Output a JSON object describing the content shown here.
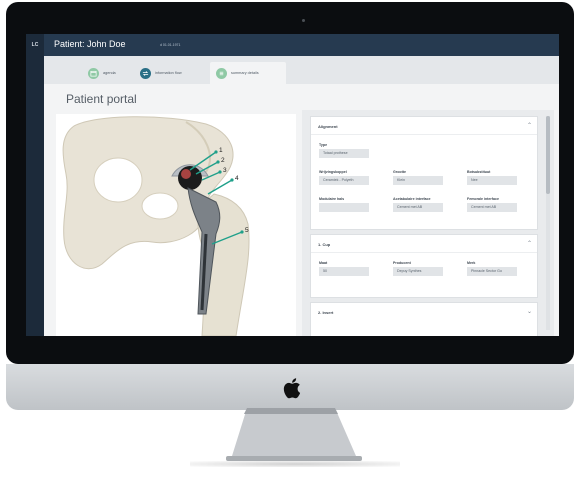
{
  "app": {
    "initials": "LC",
    "patient_name": "Patient: John Doe",
    "patient_meta": "d 01.01.1971"
  },
  "tabs": [
    {
      "label": "agenda",
      "active": false,
      "icon": "calendar-icon",
      "color": "#8fc9a5"
    },
    {
      "label": "information flow",
      "active": false,
      "icon": "arrows-icon",
      "color": "#2a6f86"
    },
    {
      "label": "summary details",
      "active": true,
      "icon": "list-icon",
      "color": "#8fc9a5"
    }
  ],
  "page_title": "Patient portal",
  "anatomy": {
    "callouts": [
      "1",
      "2",
      "3",
      "4",
      "5"
    ],
    "callout_color": "#1fa08a"
  },
  "sections": {
    "alignment": {
      "title": "Alignment",
      "fields": [
        {
          "label": "Type",
          "value": "Totaal prothese"
        },
        {
          "label": "Wrijvingskoppel",
          "value": "Ceramiek - Polyeth"
        },
        {
          "label": "Grootte",
          "value": "Klein"
        },
        {
          "label": "Botsubstituut",
          "value": "Nee"
        },
        {
          "label": "Modulaire hals",
          "value": ""
        },
        {
          "label": "Acetabulaire interface",
          "value": "Cement met AB"
        },
        {
          "label": "Femorale interface",
          "value": "Cement met AB"
        }
      ]
    },
    "cup": {
      "title": "1. Cup",
      "fields": [
        {
          "label": "Maat",
          "value": "50"
        },
        {
          "label": "Producent",
          "value": "Depuy Synthes"
        },
        {
          "label": "Merk",
          "value": "Pinnacle Sector Go"
        }
      ]
    },
    "insert": {
      "title": "2. Insert"
    }
  },
  "colors": {
    "header": "#263a50",
    "rail": "#1c2a3a",
    "panel": "#e9ebed"
  }
}
